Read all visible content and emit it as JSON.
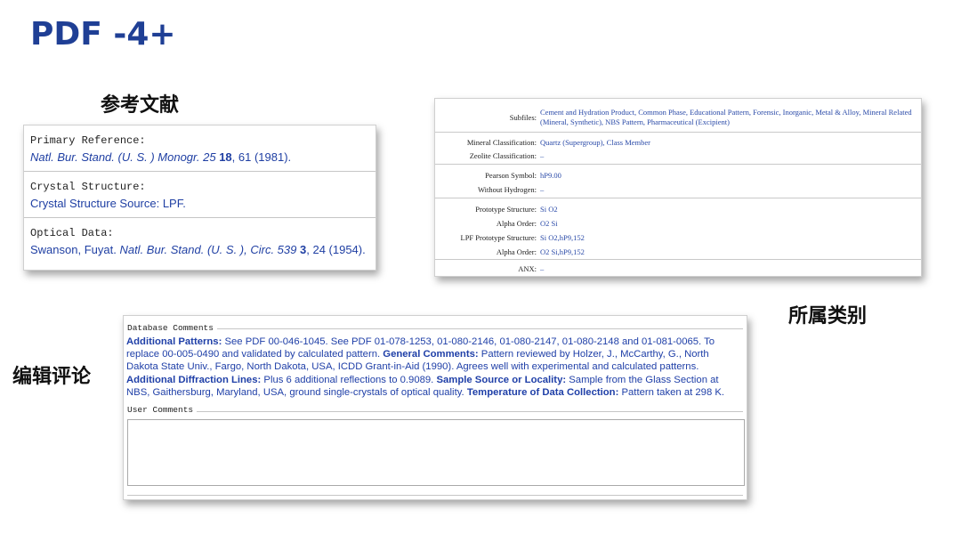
{
  "slide": {
    "title": "PDF -4+",
    "captions": {
      "references": "参考文献",
      "classification": "所属类别",
      "comments": "编辑评论"
    }
  },
  "references": {
    "primary": {
      "label": "Primary Reference:",
      "journal": "Natl. Bur. Stand. (U. S. ) Monogr. 25",
      "volume": "18",
      "rest": ", 61 (1981)."
    },
    "structure": {
      "label": "Crystal Structure:",
      "value": "Crystal Structure Source: LPF."
    },
    "optical": {
      "label": "Optical Data:",
      "authors": "Swanson, Fuyat.",
      "journal": "Natl. Bur. Stand. (U. S. ), Circ. 539",
      "volume": "3",
      "rest": ", 24 (1954)."
    }
  },
  "classification": {
    "subfiles_label": "Subfiles:",
    "subfiles_value": "Cement and Hydration Product, Common Phase, Educational Pattern, Forensic, Inorganic, Metal & Alloy, Mineral Related (Mineral, Synthetic), NBS Pattern, Pharmaceutical (Excipient)",
    "mineral_label": "Mineral Classification:",
    "mineral_value": "Quartz (Supergroup), Class Member",
    "zeolite_label": "Zeolite Classification:",
    "zeolite_value": "–",
    "pearson_label": "Pearson Symbol:",
    "pearson_value": "hP9.00",
    "without_h_label": "Without Hydrogen:",
    "without_h_value": "–",
    "prototype_label": "Prototype Structure:",
    "prototype_value": "Si O2",
    "alpha1_label": "Alpha Order:",
    "alpha1_value": "O2 Si",
    "lpf_label": "LPF Prototype Structure:",
    "lpf_value": "Si O2,hP9,152",
    "alpha2_label": "Alpha Order:",
    "alpha2_value": "O2 Si,hP9,152",
    "anx_label": "ANX:",
    "anx_value": "–"
  },
  "comments": {
    "db_legend": "Database Comments",
    "user_legend": "User Comments",
    "additional_patterns_label": "Additional Patterns:",
    "additional_patterns_text": " See PDF 00-046-1045. See PDF 01-078-1253, 01-080-2146, 01-080-2147, 01-080-2148 and 01-081-0065. To replace 00-005-0490 and validated by calculated pattern. ",
    "general_label": "General Comments:",
    "general_text": " Pattern reviewed by Holzer, J., McCarthy, G., North Dakota State Univ., Fargo, North Dakota, USA, ICDD Grant-in-Aid (1990). Agrees well with experimental and calculated patterns. ",
    "diffraction_label": "Additional Diffraction Lines:",
    "diffraction_text": " Plus 6 additional reflections to 0.9089. ",
    "sample_label": "Sample Source or Locality:",
    "sample_text": " Sample from the Glass Section at NBS, Gaithersburg, Maryland, USA, ground single-crystals of optical quality. ",
    "temp_label": "Temperature of Data Collection:",
    "temp_text": " Pattern taken at 298 K.",
    "user_value": ""
  }
}
